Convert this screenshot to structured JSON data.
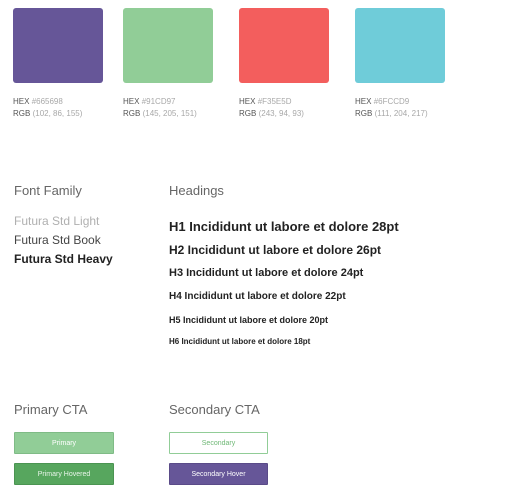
{
  "palette": [
    {
      "hex_label": "HEX",
      "hex": "#665698",
      "rgb_label": "RGB",
      "rgb": "(102, 86, 155)",
      "color": "#665698"
    },
    {
      "hex_label": "HEX",
      "hex": "#91CD97",
      "rgb_label": "RGB",
      "rgb": "(145, 205, 151)",
      "color": "#91CD97"
    },
    {
      "hex_label": "HEX",
      "hex": "#F35E5D",
      "rgb_label": "RGB",
      "rgb": "(243, 94, 93)",
      "color": "#F35E5D"
    },
    {
      "hex_label": "HEX",
      "hex": "#6FCCD9",
      "rgb_label": "RGB",
      "rgb": "(111, 204, 217)",
      "color": "#6FCCD9"
    }
  ],
  "font_family": {
    "title": "Font Family",
    "light": "Futura Std Light",
    "book": "Futura Std Book",
    "heavy": "Futura Std Heavy"
  },
  "headings": {
    "title": "Headings",
    "h1": "H1 Incididunt ut labore et dolore 28pt",
    "h2": "H2 Incididunt ut labore et dolore 26pt",
    "h3": "H3 Incididunt ut labore et dolore 24pt",
    "h4": "H4 Incididunt ut labore et dolore 22pt",
    "h5": "H5 Incididunt ut labore et dolore 20pt",
    "h6": "H6 Incididunt ut labore et dolore 18pt"
  },
  "primary_cta": {
    "title": "Primary CTA",
    "primary_label": "Primary",
    "primary_hover_label": "Primary Hovered"
  },
  "secondary_cta": {
    "title": "Secondary CTA",
    "secondary_label": "Secondary",
    "secondary_hover_label": "Secondary Hover"
  }
}
